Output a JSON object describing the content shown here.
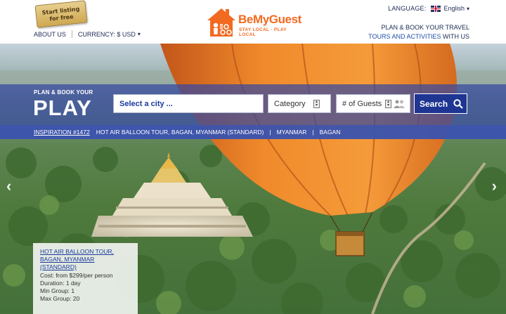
{
  "header": {
    "listing_tag_line1": "Start listing",
    "listing_tag_line2": "for free",
    "about_us": "ABOUT US",
    "currency": "CURRENCY: $ USD",
    "logo_name_be": "Be",
    "logo_name_rest": "MyGuest",
    "logo_tagline": "STAY LOCAL · PLAY LOCAL",
    "language_label": "LANGUAGE:",
    "language_value": "English",
    "travel_line1": "PLAN & BOOK YOUR TRAVEL",
    "travel_link": "TOURS AND ACTIVITIES",
    "travel_suffix": " WITH US"
  },
  "search": {
    "plan_small": "PLAN & BOOK YOUR",
    "plan_big": "PLAY",
    "city_placeholder": "Select a city ...",
    "category_label": "Category",
    "guests_label": "# of Guests",
    "button_label": "Search"
  },
  "inspiration": {
    "link": "INSPIRATION #1472",
    "title": "HOT AIR BALLOON TOUR, BAGAN, MYANMAR (STANDARD)",
    "sep": "|",
    "country": "MYANMAR",
    "city": "BAGAN"
  },
  "card": {
    "title": "HOT AIR BALLOON TOUR, BAGAN, MYANMAR (STANDARD)",
    "cost": "Cost: from $299/per person",
    "duration": "Duration: 1 day",
    "min_group": "Min Group: 1",
    "max_group": "Max Group: 20"
  },
  "icons": {
    "prev": "chevron-left-icon",
    "next": "chevron-right-icon",
    "search": "magnifier-icon",
    "guests": "people-icon"
  },
  "colors": {
    "brand_orange": "#f26a21",
    "nav_blue": "#1d2b55",
    "band_blue": "#3448a0",
    "button_blue": "#1e3592"
  }
}
